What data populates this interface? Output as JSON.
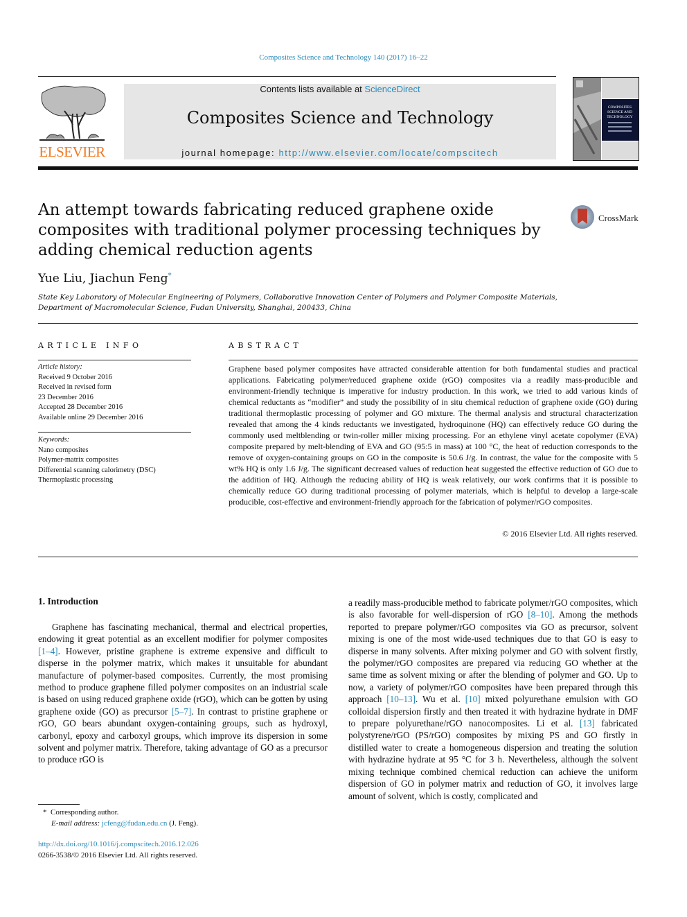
{
  "header": {
    "running_head": "Composites Science and Technology 140 (2017) 16–22",
    "publisher_logo_text": "ELSEVIER",
    "contents_prefix": "Contents lists available at ",
    "contents_link": "ScienceDirect",
    "journal_title": "Composites Science and Technology",
    "homepage_prefix": "journal homepage: ",
    "homepage_url": "http://www.elsevier.com/locate/compscitech",
    "cover_title_lines": [
      "COMPOSITES",
      "SCIENCE AND",
      "TECHNOLOGY"
    ]
  },
  "article": {
    "title": "An attempt towards fabricating reduced graphene oxide composites with traditional polymer processing techniques by adding chemical reduction agents",
    "crossmark_label": "CrossMark",
    "authors": "Yue Liu, Jiachun Feng",
    "author_mark": "*",
    "affiliation": "State Key Laboratory of Molecular Engineering of Polymers, Collaborative Innovation Center of Polymers and Polymer Composite Materials, Department of Macromolecular Science, Fudan University, Shanghai, 200433, China"
  },
  "article_info": {
    "heading": "ARTICLE INFO",
    "history_label": "Article history:",
    "history": [
      "Received 9 October 2016",
      "Received in revised form",
      "23 December 2016",
      "Accepted 28 December 2016",
      "Available online 29 December 2016"
    ],
    "keywords_label": "Keywords:",
    "keywords": [
      "Nano composites",
      "Polymer-matrix composites",
      "Differential scanning calorimetry (DSC)",
      "Thermoplastic processing"
    ]
  },
  "abstract": {
    "heading": "ABSTRACT",
    "text": "Graphene based polymer composites have attracted considerable attention for both fundamental studies and practical applications. Fabricating polymer/reduced graphene oxide (rGO) composites via a readily mass-producible and environment-friendly technique is imperative for industry production. In this work, we tried to add various kinds of chemical reductants as “modifier” and study the possibility of in situ chemical reduction of graphene oxide (GO) during traditional thermoplastic processing of polymer and GO mixture. The thermal analysis and structural characterization revealed that among the 4 kinds re­ductants we investigated, hydroquinone (HQ) can effectively reduce GO during the commonly used melt­blending or twin-roller miller mixing processing. For an ethylene vinyl acetate copolymer (EVA) com­posite prepared by melt-blending of EVA and GO (95:5 in mass) at 100 °C, the heat of reduction cor­responds to the remove of oxygen-containing groups on GO in the composite is 50.6 J/g. In contrast, the value for the composite with 5 wt% HQ is only 1.6 J/g. The significant decreased values of reduction heat suggested the effective reduction of GO due to the addition of HQ. Although the reducing ability of HQ is weak relatively, our work confirms that it is possible to chemically reduce GO during traditional pro­cessing of polymer materials, which is helpful to develop a large-scale producible, cost-effective and environment-friendly approach for the fabrication of polymer/rGO composites.",
    "copyright": "© 2016 Elsevier Ltd. All rights reserved."
  },
  "introduction": {
    "heading": "1.  Introduction",
    "left": [
      {
        "t": "Graphene has fascinating mechanical, thermal and electrical properties, endowing it great potential as an excellent modifier for polymer composites "
      },
      {
        "ref": "[1–4]"
      },
      {
        "t": ". However, pristine graphene is extreme expensive and difficult to disperse in the polymer matrix, which makes it unsuitable for abundant manufacture of polymer-based composites. Currently, the most promising method to produce graphene filled polymer composites on an industrial scale is based on using reduced graphene oxide (rGO), which can be gotten by using graphene oxide (GO) as precursor "
      },
      {
        "ref": "[5–7]"
      },
      {
        "t": ". In contrast to pristine graphene or rGO, GO bears abundant oxygen-containing groups, such as hydroxyl, carbonyl, epoxy and carboxyl groups, which improve its dispersion in some solvent and polymer matrix. Therefore, taking advantage of GO as a precursor to produce rGO is"
      }
    ],
    "right": [
      {
        "t": "a readily mass-producible method to fabricate polymer/rGO composites, which is also favorable for well-dispersion of rGO "
      },
      {
        "ref": "[8–10]"
      },
      {
        "t": ". Among the methods reported to prepare polymer/rGO composites via GO as precursor, solvent mixing is one of the most wide-used techniques due to that GO is easy to disperse in many solvents. After mixing polymer and GO with solvent firstly, the polymer/rGO composites are prepared via reducing GO whether at the same time as solvent mixing or after the blending of polymer and GO. Up to now, a variety of polymer/rGO composites have been prepared through this approach "
      },
      {
        "ref": "[10–13]"
      },
      {
        "t": ". Wu et al. "
      },
      {
        "ref": "[10]"
      },
      {
        "t": " mixed polyurethane emulsion with GO colloidal dispersion firstly and then treated it with hydrazine hydrate in DMF to prepare polyurethane/rGO nanocomposites. Li et al. "
      },
      {
        "ref": "[13]"
      },
      {
        "t": " fabricated polystyrene/rGO (PS/rGO) composites by mixing PS and GO firstly in distilled water to create a homogeneous dispersion and treating the solution with hydrazine hydrate at 95 °C for 3 h. Nevertheless, although the solvent mixing technique combined chemical reduction can achieve the uniform dispersion of GO in polymer matrix and reduction of GO, it involves large amount of solvent, which is costly, complicated and"
      }
    ]
  },
  "footnote": {
    "mark": "*",
    "corresponding": "Corresponding author.",
    "email_label": "E-mail address: ",
    "email": "jcfeng@fudan.edu.cn",
    "email_suffix": " (J. Feng)."
  },
  "doi": {
    "url": "http://dx.doi.org/10.1016/j.compscitech.2016.12.026",
    "issn_line": "0266-3538/© 2016 Elsevier Ltd. All rights reserved."
  },
  "colors": {
    "link": "#2a8ab8",
    "elsevier_orange": "#f07a22",
    "masthead_bg": "#e6e6e6"
  }
}
